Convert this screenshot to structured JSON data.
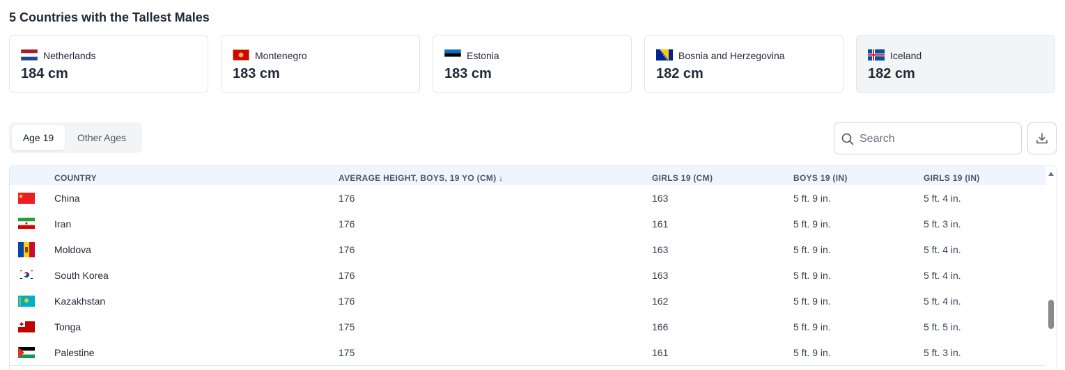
{
  "title": "5 Countries with the Tallest Males",
  "cards": [
    {
      "name": "Netherlands",
      "value": "184 cm",
      "flag": "netherlands-flag-icon"
    },
    {
      "name": "Montenegro",
      "value": "183 cm",
      "flag": "montenegro-flag-icon"
    },
    {
      "name": "Estonia",
      "value": "183 cm",
      "flag": "estonia-flag-icon"
    },
    {
      "name": "Bosnia and Herzegovina",
      "value": "182 cm",
      "flag": "bosnia-flag-icon"
    },
    {
      "name": "Iceland",
      "value": "182 cm",
      "flag": "iceland-flag-icon",
      "selected": true
    }
  ],
  "tabs": [
    {
      "label": "Age 19",
      "active": true
    },
    {
      "label": "Other Ages",
      "active": false
    }
  ],
  "search": {
    "placeholder": "Search",
    "value": ""
  },
  "download": {
    "icon": "download-icon"
  },
  "table": {
    "columns": [
      "COUNTRY",
      "AVERAGE HEIGHT, BOYS, 19 YO (CM) ↓",
      "GIRLS 19 (CM)",
      "BOYS 19 (IN)",
      "GIRLS 19 (IN)"
    ],
    "rows": [
      {
        "country": "China",
        "boys_cm": "176",
        "girls_cm": "163",
        "boys_in": "5 ft. 9 in.",
        "girls_in": "5 ft. 4 in.",
        "flag": "china-flag-icon"
      },
      {
        "country": "Iran",
        "boys_cm": "176",
        "girls_cm": "161",
        "boys_in": "5 ft. 9 in.",
        "girls_in": "5 ft. 3 in.",
        "flag": "iran-flag-icon"
      },
      {
        "country": "Moldova",
        "boys_cm": "176",
        "girls_cm": "163",
        "boys_in": "5 ft. 9 in.",
        "girls_in": "5 ft. 4 in.",
        "flag": "moldova-flag-icon"
      },
      {
        "country": "South Korea",
        "boys_cm": "176",
        "girls_cm": "163",
        "boys_in": "5 ft. 9 in.",
        "girls_in": "5 ft. 4 in.",
        "flag": "south-korea-flag-icon"
      },
      {
        "country": "Kazakhstan",
        "boys_cm": "176",
        "girls_cm": "162",
        "boys_in": "5 ft. 9 in.",
        "girls_in": "5 ft. 4 in.",
        "flag": "kazakhstan-flag-icon"
      },
      {
        "country": "Tonga",
        "boys_cm": "175",
        "girls_cm": "166",
        "boys_in": "5 ft. 9 in.",
        "girls_in": "5 ft. 5 in.",
        "flag": "tonga-flag-icon"
      },
      {
        "country": "Palestine",
        "boys_cm": "175",
        "girls_cm": "161",
        "boys_in": "5 ft. 9 in.",
        "girls_in": "5 ft. 3 in.",
        "flag": "palestine-flag-icon"
      }
    ]
  }
}
